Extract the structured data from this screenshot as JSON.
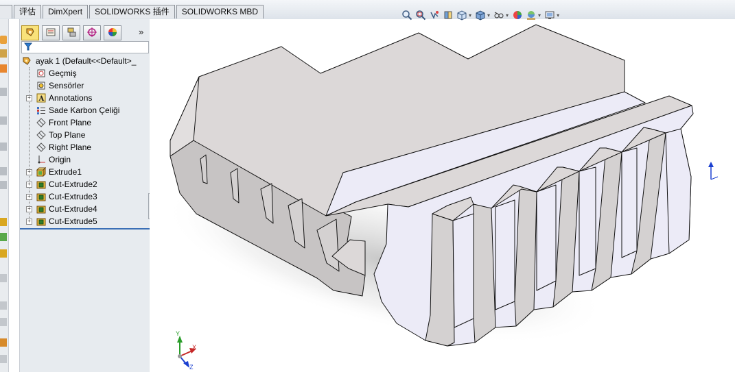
{
  "command_tabs": [
    {
      "label": "评估"
    },
    {
      "label": "DimXpert"
    },
    {
      "label": "SOLIDWORKS 插件"
    },
    {
      "label": "SOLIDWORKS MBD"
    }
  ],
  "partially_hidden_tab": {
    "label": ""
  },
  "view_toolbar": [
    {
      "icon": "zoom-to-fit-icon"
    },
    {
      "icon": "zoom-to-area-icon"
    },
    {
      "icon": "previous-view-icon"
    },
    {
      "icon": "section-view-icon"
    },
    {
      "icon": "view-orientation-icon"
    },
    {
      "icon": "display-style-icon"
    },
    {
      "icon": "hide-show-items-icon"
    },
    {
      "icon": "edit-appearance-icon"
    },
    {
      "icon": "apply-scene-icon"
    },
    {
      "icon": "view-settings-icon"
    }
  ],
  "feature_manager": {
    "tabs": [
      {
        "icon": "featuremanager-tree-icon"
      },
      {
        "icon": "propertymanager-icon"
      },
      {
        "icon": "configurationmanager-icon"
      },
      {
        "icon": "dimxpertmanager-icon"
      },
      {
        "icon": "displaymanager-icon"
      }
    ],
    "expand_symbol": "»",
    "filter_placeholder": "",
    "tree": {
      "root_label": "ayak 1  (Default<<Default>_",
      "items": [
        {
          "label": "Geçmiş",
          "icon": "history-icon",
          "expandable": false
        },
        {
          "label": "Sensörler",
          "icon": "sensors-icon",
          "expandable": false
        },
        {
          "label": "Annotations",
          "icon": "annotations-icon",
          "expandable": true
        },
        {
          "label": "Sade Karbon Çeliği",
          "icon": "material-icon",
          "expandable": false
        },
        {
          "label": "Front Plane",
          "icon": "plane-icon",
          "expandable": false
        },
        {
          "label": "Top Plane",
          "icon": "plane-icon",
          "expandable": false
        },
        {
          "label": "Right Plane",
          "icon": "plane-icon",
          "expandable": false
        },
        {
          "label": "Origin",
          "icon": "origin-icon",
          "expandable": false
        },
        {
          "label": "Extrude1",
          "icon": "extrude-icon",
          "expandable": true
        },
        {
          "label": "Cut-Extrude2",
          "icon": "cut-extrude-icon",
          "expandable": true
        },
        {
          "label": "Cut-Extrude3",
          "icon": "cut-extrude-icon",
          "expandable": true
        },
        {
          "label": "Cut-Extrude4",
          "icon": "cut-extrude-icon",
          "expandable": true
        },
        {
          "label": "Cut-Extrude5",
          "icon": "cut-extrude-icon",
          "expandable": true
        }
      ]
    }
  },
  "triad": {
    "x_label": "X",
    "y_label": "Y",
    "z_label": "Z"
  },
  "colors": {
    "face_top": "#dcd8d8",
    "face_front": "#ecebf7",
    "face_side": "#c9c6c6",
    "edge": "#111111",
    "selection_blue": "#3b6fb6"
  }
}
